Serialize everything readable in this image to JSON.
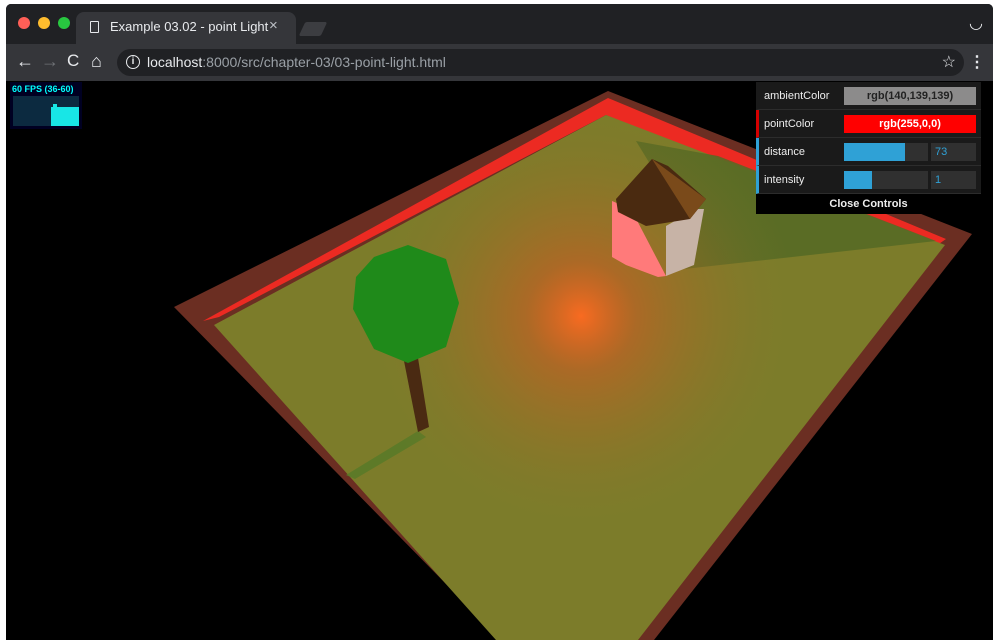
{
  "browser": {
    "tab_title": "Example 03.02 - point Light",
    "tab_close": "×",
    "url_host": "localhost",
    "url_path": ":8000/src/chapter-03/03-point-light.html",
    "icons": {
      "back": "arrow-left-icon",
      "forward": "arrow-right-icon",
      "reload": "reload-icon",
      "home": "home-icon",
      "info": "info-icon",
      "bookmark": "star-icon",
      "menu": "kebab-menu-icon",
      "incognito": "incognito-icon"
    }
  },
  "stats": {
    "text": "60 FPS (36-60)",
    "fps": 60,
    "min": 36,
    "max": 60
  },
  "controls": {
    "ambient_label": "ambientColor",
    "ambient_value": "rgb(140,139,139)",
    "point_label": "pointColor",
    "point_value": "rgb(255,0,0)",
    "distance_label": "distance",
    "distance_value": "73",
    "distance_fill": 0.73,
    "intensity_label": "intensity",
    "intensity_value": "1",
    "intensity_fill": 0.33,
    "close_label": "Close Controls"
  },
  "colors": {
    "ambient": "#8c8b8b",
    "point": "#ff0000",
    "ground": "#7c7c2a",
    "wall": "#6b2e22",
    "point_glow": "#ff6a20"
  }
}
